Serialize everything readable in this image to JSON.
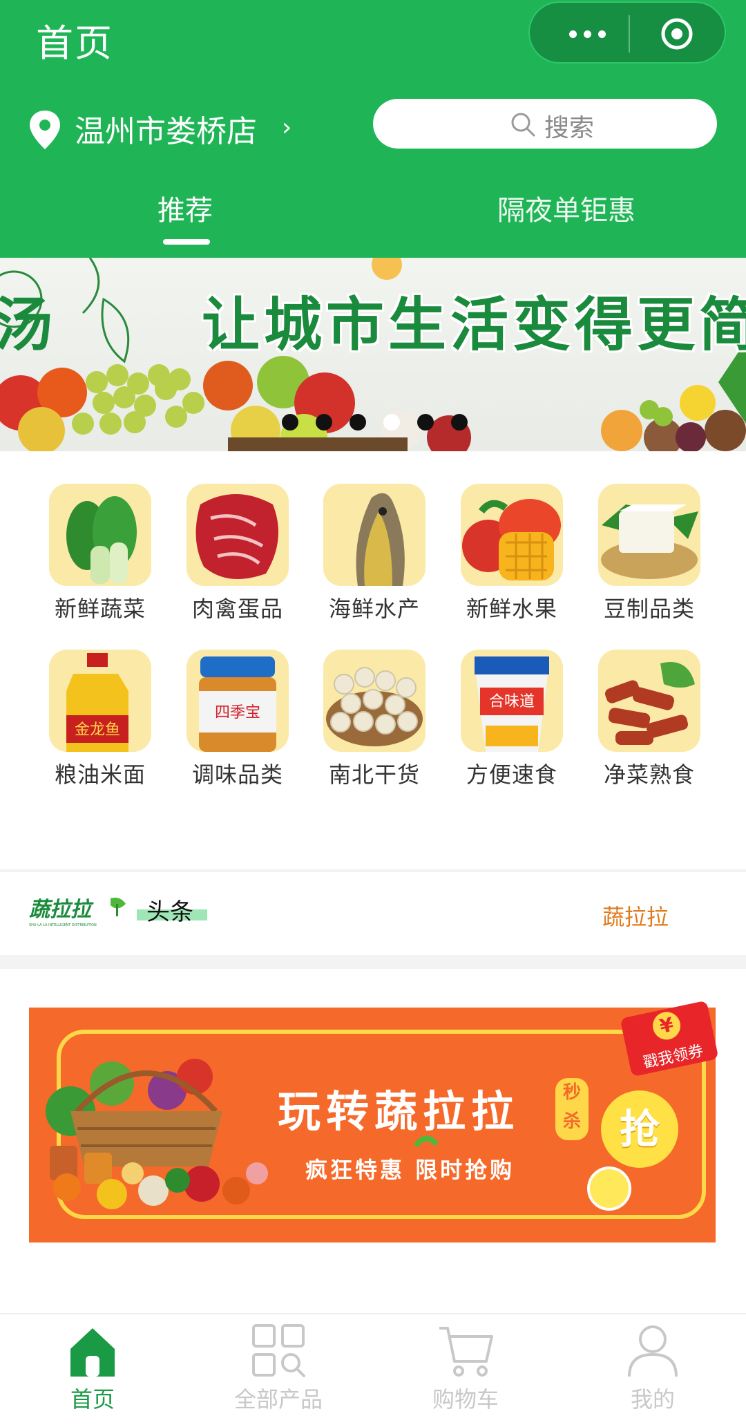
{
  "topbar": {
    "title": "首页"
  },
  "store": {
    "name": "温州市娄桥店",
    "chevron": "›"
  },
  "search": {
    "placeholder": "搜索"
  },
  "tabs": [
    {
      "label": "推荐",
      "active": true
    },
    {
      "label": "隔夜单钜惠",
      "active": false
    }
  ],
  "banner": {
    "text": "让城市生活变得更简",
    "text_left": "汤",
    "slide_count": 6,
    "active_index": 3
  },
  "categories": [
    {
      "label": "新鲜蔬菜",
      "icon": "bok-choy-icon"
    },
    {
      "label": "肉禽蛋品",
      "icon": "steak-icon"
    },
    {
      "label": "海鲜水产",
      "icon": "fish-icon"
    },
    {
      "label": "新鲜水果",
      "icon": "mango-icon"
    },
    {
      "label": "豆制品类",
      "icon": "tofu-icon"
    },
    {
      "label": "粮油米面",
      "icon": "oil-bottle-icon"
    },
    {
      "label": "调味品类",
      "icon": "peanut-butter-jar-icon"
    },
    {
      "label": "南北干货",
      "icon": "lotus-seeds-icon"
    },
    {
      "label": "方便速食",
      "icon": "cup-noodles-icon"
    },
    {
      "label": "净菜熟食",
      "icon": "cooked-meat-icon"
    }
  ],
  "news": {
    "logo_text": "蔬拉拉",
    "logo_sub": "SHU LA LA INTELLIGENT DISTRIBUTION",
    "headline_label": "头条",
    "right_text": "蔬拉拉"
  },
  "promo": {
    "title": "玩转蔬拉拉",
    "badge": "秒杀",
    "subtitle": "疯狂特惠  限时抢购",
    "grab": "抢",
    "coupon_symbol": "¥",
    "coupon_label": "戳我领券"
  },
  "tabbar": [
    {
      "label": "首页",
      "active": true
    },
    {
      "label": "全部产品",
      "active": false
    },
    {
      "label": "购物车",
      "active": false
    },
    {
      "label": "我的",
      "active": false
    }
  ],
  "colors": {
    "brand_green": "#1fb556",
    "active_tab": "#1a9a45",
    "inactive_tab": "#c8c8c8",
    "accent_orange": "#e07a1c",
    "promo_orange": "#f56a2a"
  }
}
